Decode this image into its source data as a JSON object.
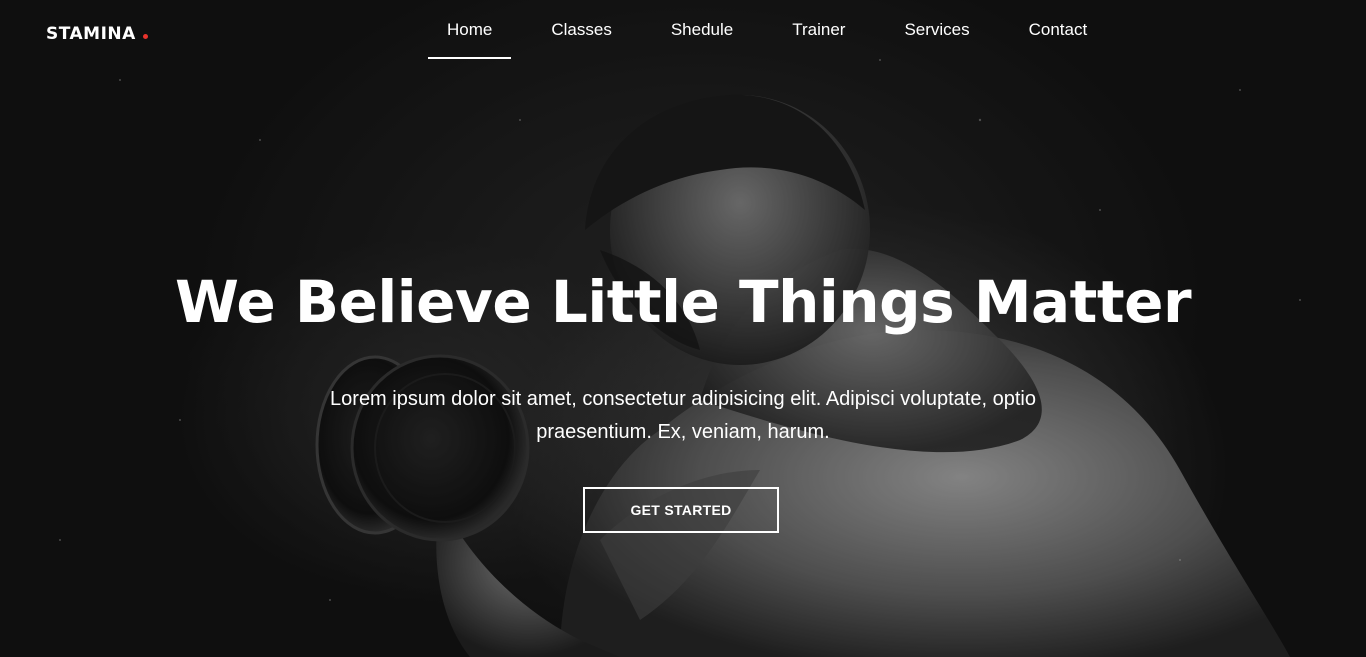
{
  "brand": {
    "name": "STAMINA",
    "accent_color": "#e8332c"
  },
  "nav": {
    "items": [
      {
        "label": "Home",
        "active": true
      },
      {
        "label": "Classes",
        "active": false
      },
      {
        "label": "Shedule",
        "active": false
      },
      {
        "label": "Trainer",
        "active": false
      },
      {
        "label": "Services",
        "active": false
      },
      {
        "label": "Contact",
        "active": false
      }
    ]
  },
  "hero": {
    "headline": "We Believe Little Things Matter",
    "subtext": "Lorem ipsum dolor sit amet, consectetur adipisicing elit. Adipisci voluptate, optio praesentium. Ex, veniam, harum.",
    "cta_label": "GET STARTED",
    "background_image": "black-and-white-photo-of-bodybuilder-lifting-dumbbell"
  }
}
